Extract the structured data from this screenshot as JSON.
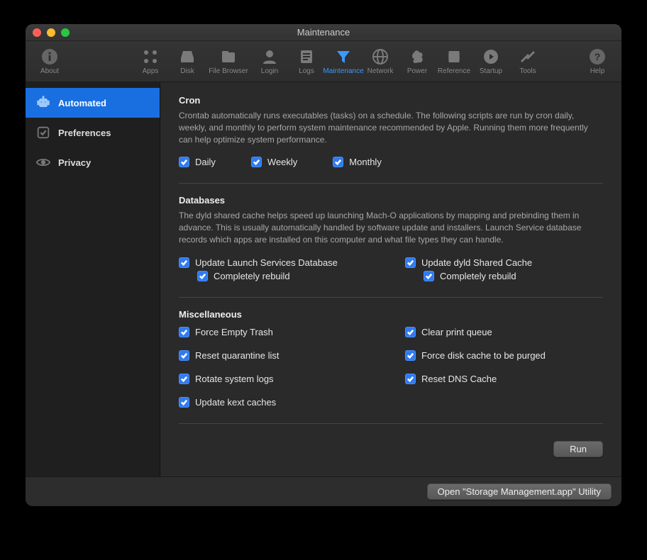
{
  "window": {
    "title": "Maintenance"
  },
  "toolbar": {
    "about": "About",
    "items": [
      {
        "label": "Apps"
      },
      {
        "label": "Disk"
      },
      {
        "label": "File Browser"
      },
      {
        "label": "Login"
      },
      {
        "label": "Logs"
      },
      {
        "label": "Maintenance"
      },
      {
        "label": "Network"
      },
      {
        "label": "Power"
      },
      {
        "label": "Reference"
      },
      {
        "label": "Startup"
      },
      {
        "label": "Tools"
      }
    ],
    "help": "Help"
  },
  "sidebar": {
    "items": [
      {
        "label": "Automated",
        "selected": true
      },
      {
        "label": "Preferences",
        "selected": false
      },
      {
        "label": "Privacy",
        "selected": false
      }
    ]
  },
  "sections": {
    "cron": {
      "title": "Cron",
      "description": "Crontab automatically runs executables (tasks) on a schedule. The following scripts are run by cron daily, weekly, and monthly to perform system maintenance recommended by Apple. Running them more frequently can help optimize system performance.",
      "options": {
        "daily": "Daily",
        "weekly": "Weekly",
        "monthly": "Monthly"
      }
    },
    "databases": {
      "title": "Databases",
      "description": "The dyld shared cache helps speed up launching Mach-O applications by mapping and prebinding them in advance. This is usually automatically handled by software update and installers. Launch Service database records which apps are installed on this computer and what file types they can handle.",
      "left": {
        "main": "Update Launch Services Database",
        "sub": "Completely rebuild"
      },
      "right": {
        "main": "Update dyld Shared Cache",
        "sub": "Completely rebuild"
      }
    },
    "misc": {
      "title": "Miscellaneous",
      "items": [
        "Force Empty Trash",
        "Clear print queue",
        "Reset quarantine list",
        "Force disk cache to be purged",
        "Rotate system logs",
        "Reset DNS Cache",
        "Update kext caches"
      ]
    }
  },
  "buttons": {
    "run": "Run",
    "open_storage": "Open \"Storage Management.app\" Utility"
  }
}
